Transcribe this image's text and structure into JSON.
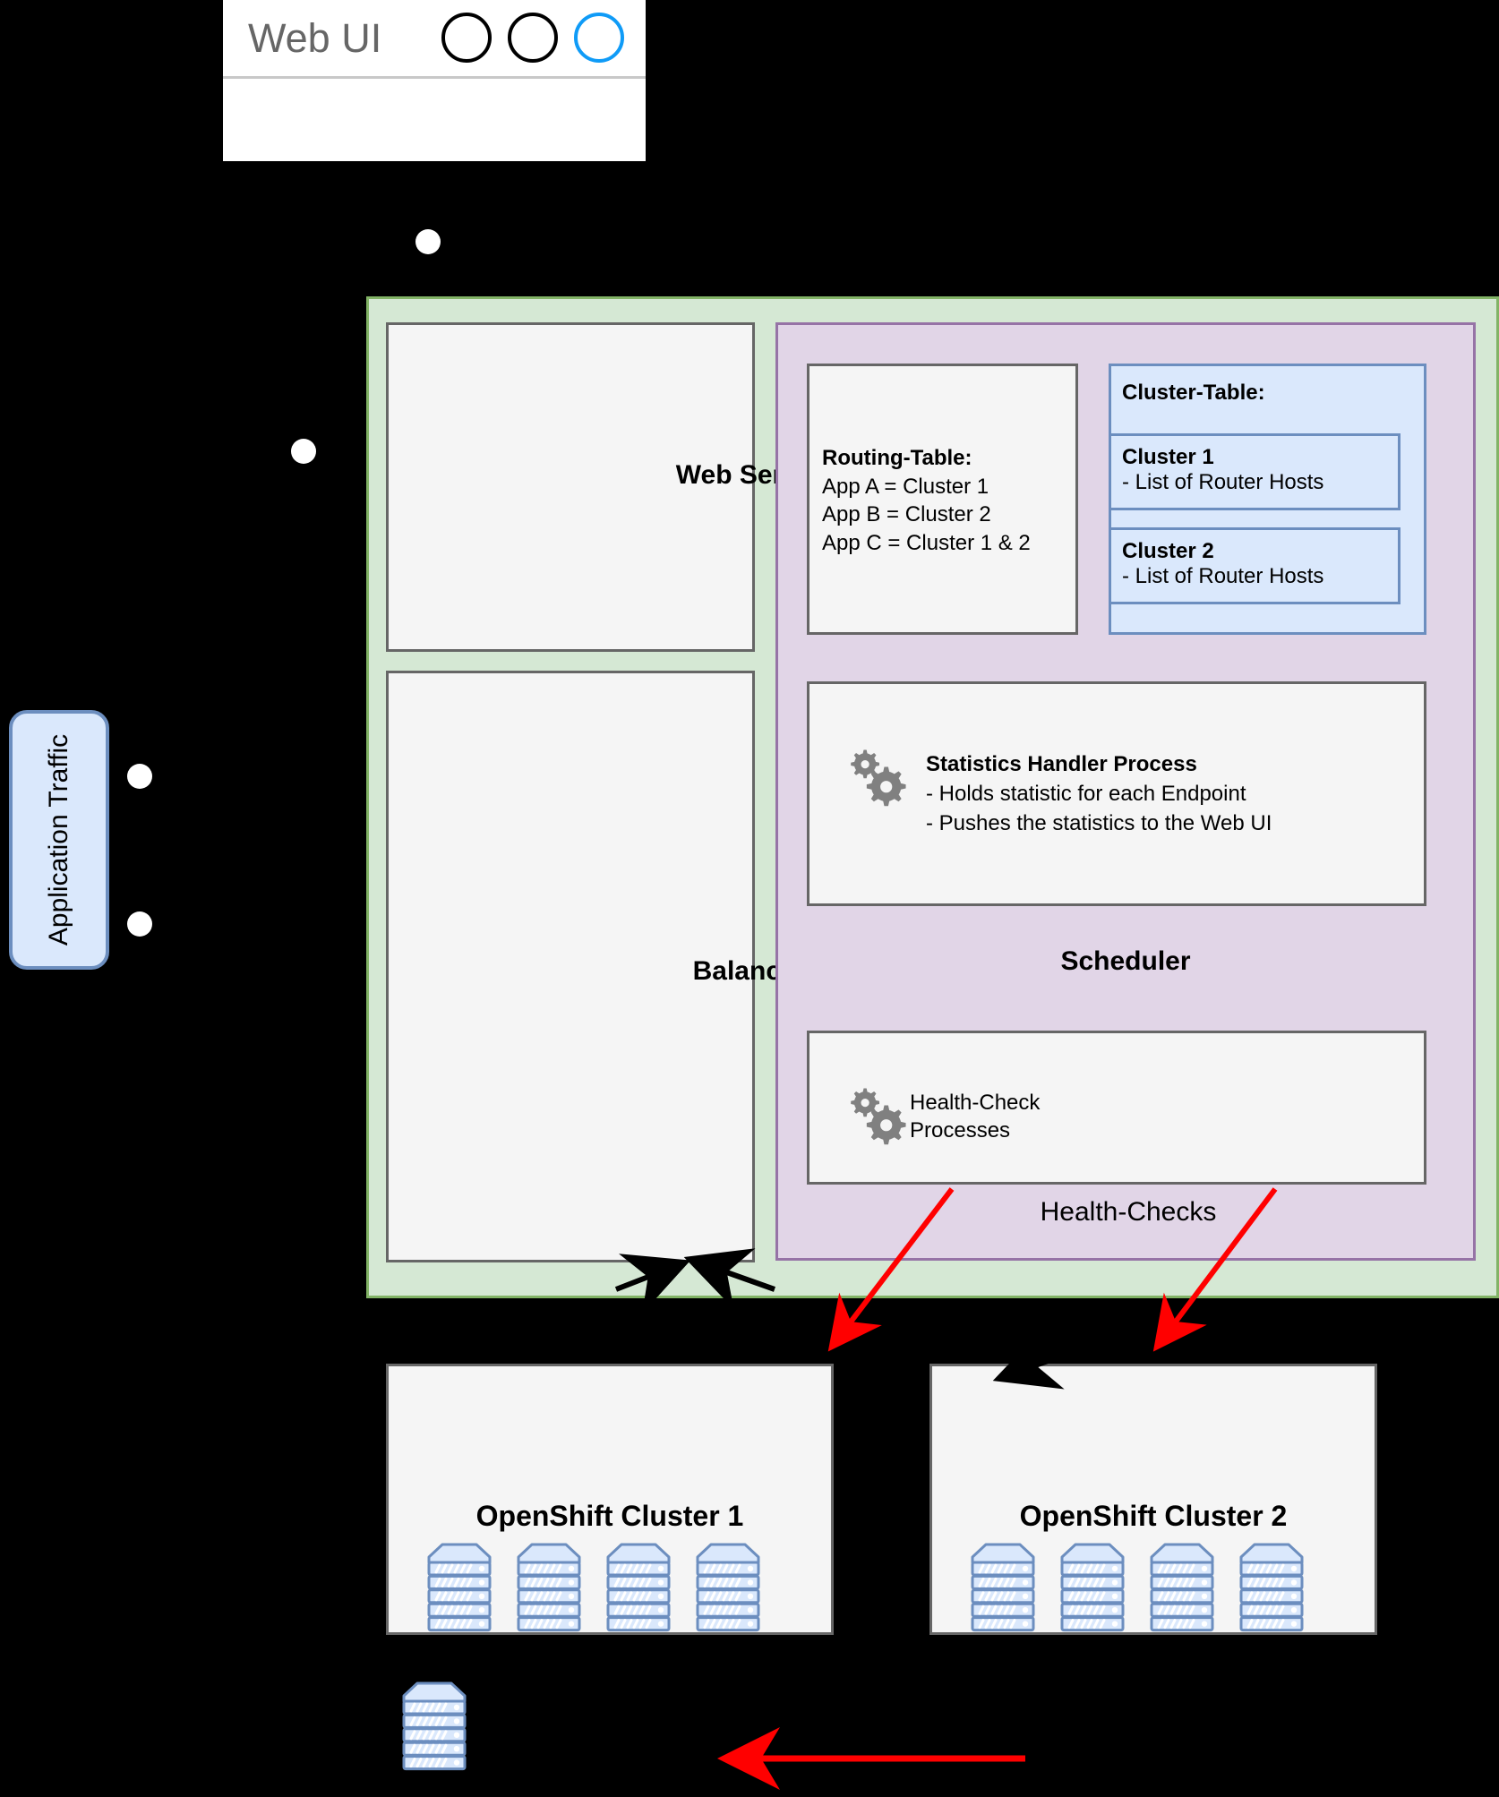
{
  "browser": {
    "title": "Web UI",
    "controls": [
      {
        "name": "circle-button-1",
        "color": "#000000"
      },
      {
        "name": "circle-button-2",
        "color": "#000000"
      },
      {
        "name": "circle-button-3",
        "color": "#0f9bf7"
      }
    ]
  },
  "app_traffic": {
    "label": "Application Traffic"
  },
  "main": {
    "web_server": {
      "label": "Web Server"
    },
    "balancer": {
      "label": "Balancer"
    }
  },
  "scheduler": {
    "label": "Scheduler",
    "routing_table": {
      "title": "Routing-Table:",
      "rows": [
        "App A = Cluster 1",
        "App B = Cluster 2",
        "App C = Cluster 1 & 2"
      ]
    },
    "cluster_table": {
      "title": "Cluster-Table:",
      "entries": [
        {
          "name": "Cluster 1",
          "desc": "- List of Router Hosts"
        },
        {
          "name": "Cluster 2",
          "desc": "- List of Router Hosts"
        }
      ]
    },
    "statistics_handler": {
      "title": "Statistics Handler Process",
      "bullets": [
        "- Holds statistic for each Endpoint",
        "- Pushes the statistics to the Web UI"
      ],
      "icon": "gears-icon"
    },
    "health_check": {
      "title_line_1": "Health-Check",
      "title_line_2": "Processes",
      "icon": "gears-icon"
    },
    "health_checks_label": "Health-Checks"
  },
  "clusters": [
    {
      "label": "OpenShift Cluster 1",
      "server_count": 4
    },
    {
      "label": "OpenShift Cluster 2",
      "server_count": 4
    }
  ],
  "legend": {
    "standalone_server_icon": "server-rack-icon",
    "arrow_color": "#ff0000"
  },
  "colors": {
    "container_fill": "#d5e8d4",
    "container_stroke": "#82b366",
    "scheduler_fill": "#e1d5e7",
    "scheduler_stroke": "#9673a6",
    "table_fill": "#dae8fc",
    "table_stroke": "#6c8ebf",
    "box_fill": "#f5f5f5",
    "box_stroke": "#666666",
    "health_arrow": "#ff0000",
    "gear": "#808080",
    "background": "#000000"
  }
}
